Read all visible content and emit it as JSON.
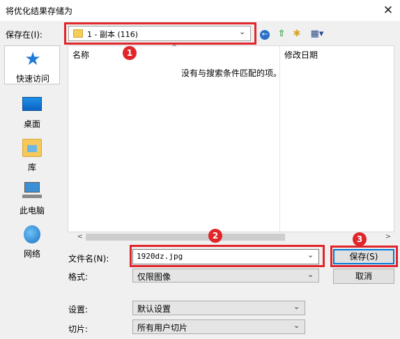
{
  "window": {
    "title": "将优化结果存储为",
    "close_glyph": "✕"
  },
  "save_in": {
    "label": "保存在(I):",
    "value": "1 - 副本 (116)",
    "chevron": "⌄"
  },
  "toolbar": {
    "back_glyph": "←",
    "up_glyph": "⇧",
    "newfolder_glyph": "✱",
    "view_glyph": "▦▾"
  },
  "places": [
    {
      "label": "快速访问",
      "icon": "quick-access-star-icon"
    },
    {
      "label": "桌面",
      "icon": "desktop-icon"
    },
    {
      "label": "库",
      "icon": "library-icon"
    },
    {
      "label": "此电脑",
      "icon": "computer-icon"
    },
    {
      "label": "网络",
      "icon": "network-icon"
    }
  ],
  "file_list": {
    "columns": [
      "名称",
      "修改日期"
    ],
    "sort_glyph": "^",
    "empty_message": "没有与搜索条件匹配的项。"
  },
  "scrollbar": {
    "left_glyph": "<",
    "right_glyph": ">"
  },
  "file_name": {
    "label": "文件名(N):",
    "value": "1920dz.jpg",
    "chevron": "⌄"
  },
  "file_type": {
    "label": "格式:",
    "value": "仅限图像",
    "chevron": "⌄"
  },
  "buttons": {
    "save": "保存(S)",
    "cancel": "取消"
  },
  "settings": {
    "label": "设置:",
    "value": "默认设置",
    "chevron": "⌄"
  },
  "slices": {
    "label": "切片:",
    "value": "所有用户切片",
    "chevron": "⌄"
  },
  "annotations": {
    "badge_1": "1",
    "badge_2": "2",
    "badge_3": "3",
    "color": "#e0262b"
  },
  "colors": {
    "accent": "#0078d7",
    "highlight": "#e0262b"
  }
}
